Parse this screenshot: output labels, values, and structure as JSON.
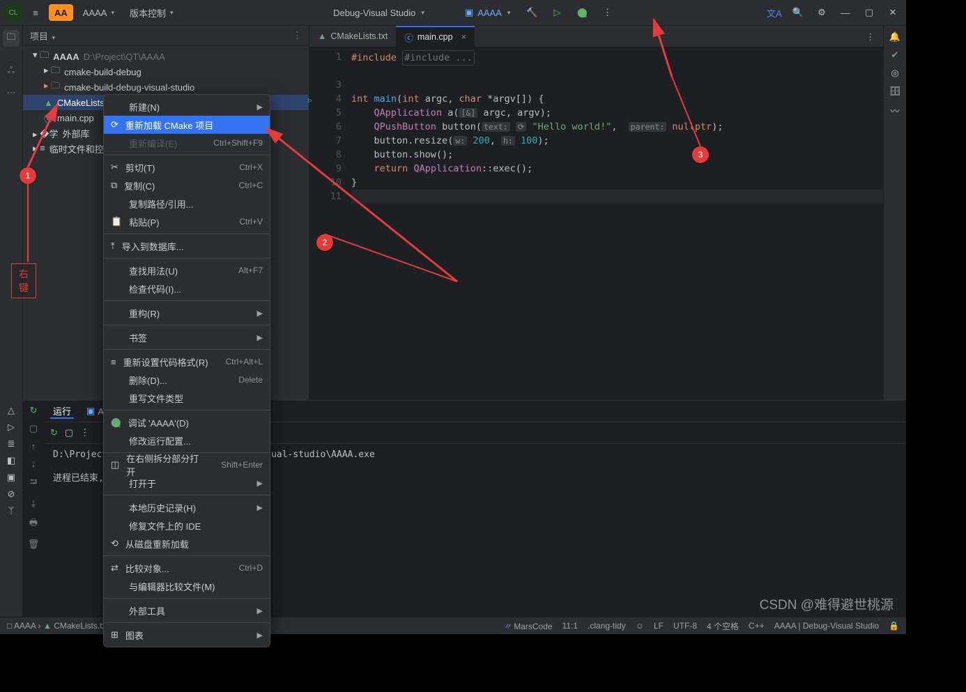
{
  "titlebar": {
    "project_badge": "AA",
    "project_name": "AAAA",
    "vcs_label": "版本控制",
    "run_config": "Debug-Visual Studio",
    "target": "AAAA"
  },
  "sidebar": {
    "title": "项目",
    "root_name": "AAAA",
    "root_path": "D:\\Project\\QT\\AAAA",
    "items": {
      "cmake_build_debug": "cmake-build-debug",
      "cmake_build_debug_vs": "cmake-build-debug-visual-studio",
      "cmakelists": "CMakeLists.txt",
      "main": "main.cpp",
      "external": "外部库",
      "scratch": "临时文件和控制台"
    }
  },
  "context_menu": {
    "new": "新建(N)",
    "reload": "重新加载 CMake 项目",
    "recompile": "重新编译(E)",
    "recompile_sc": "Ctrl+Shift+F9",
    "cut": "剪切(T)",
    "cut_sc": "Ctrl+X",
    "copy": "复制(C)",
    "copy_sc": "Ctrl+C",
    "copy_path": "复制路径/引用...",
    "paste": "粘贴(P)",
    "paste_sc": "Ctrl+V",
    "import_db": "导入到数据库...",
    "find_usages": "查找用法(U)",
    "find_usages_sc": "Alt+F7",
    "inspect": "检查代码(I)...",
    "refactor": "重构(R)",
    "bookmarks": "书签",
    "reformat": "重新设置代码格式(R)",
    "reformat_sc": "Ctrl+Alt+L",
    "delete": "删除(D)...",
    "delete_sc": "Delete",
    "override": "重写文件类型",
    "debug": "调试 'AAAA'(D)",
    "edit_run": "修改运行配置...",
    "open_right": "在右侧拆分部分打开",
    "open_right_sc": "Shift+Enter",
    "open_in": "打开于",
    "local_hist": "本地历史记录(H)",
    "repair_ide": "修复文件上的 IDE",
    "reload_disk": "从磁盘重新加载",
    "compare": "比较对象...",
    "compare_sc": "Ctrl+D",
    "compare_editor": "与编辑器比较文件(M)",
    "ext_tools": "外部工具",
    "diagrams": "图表"
  },
  "tabs": {
    "cmakelists": "CMakeLists.txt",
    "main": "main.cpp"
  },
  "code": {
    "l1": "#include ...",
    "l4a": "int",
    "l4b": "main",
    "l4c": "int",
    "l4d": "argc",
    "l4e": "char",
    "l4f": "*argv[]",
    "l5a": "QApplication",
    "l5b": "a",
    "l5c": "argc, argv",
    "l6a": "QPushButton",
    "l6b": "button",
    "l6c": "\"Hello world!\"",
    "l6d": "nullptr",
    "l7a": "button.resize",
    "l7b": "200",
    "l7c": "100",
    "l8": "button.show();",
    "l9a": "return",
    "l9b": "QApplication",
    "l9c": "::exec();",
    "inlay_amp": "[&]",
    "inlay_text": "text:",
    "inlay_parent": "parent:",
    "inlay_w": "w:",
    "inlay_h": "h:",
    "inlay_sync": "⟳"
  },
  "run": {
    "tab_run": "运行",
    "tab_target": "AAAA",
    "path": "D:\\Project\\QT\\AAAA\\cmake-build-debug-visual-studio\\AAAA.exe",
    "finished": "进程已结束,退出代码为 0"
  },
  "statusbar": {
    "breadcrumb_project": "AAAA",
    "breadcrumb_file": "CMakeLists.txt",
    "marscode": "MarsCode",
    "pos": "11:1",
    "analyzer": ".clang-tidy",
    "encoding": "UTF-8",
    "le": "LF",
    "indent": "4 个空格",
    "lang": "C++",
    "context": "AAAA | Debug-Visual Studio"
  },
  "annotations": {
    "rightclick": "右键",
    "n1": "1",
    "n2": "2",
    "n3": "3"
  },
  "watermark": "CSDN @难得避世桃源"
}
